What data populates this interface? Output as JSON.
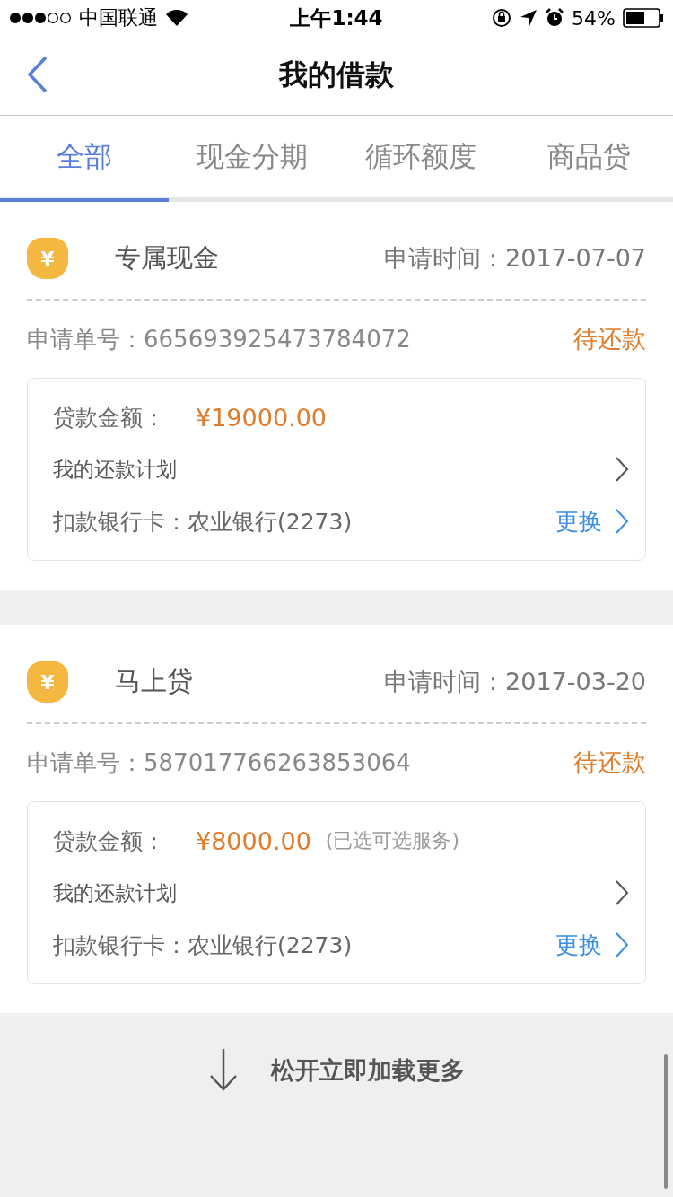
{
  "status_bar": {
    "carrier": "中国联通",
    "time": "上午1:44",
    "battery": "54%"
  },
  "nav": {
    "title": "我的借款"
  },
  "tabs": [
    {
      "label": "全部",
      "selected": true
    },
    {
      "label": "现金分期",
      "selected": false
    },
    {
      "label": "循环额度",
      "selected": false
    },
    {
      "label": "商品贷",
      "selected": false
    }
  ],
  "loans": [
    {
      "icon": "¥",
      "product": "专属现金",
      "date_label": "申请时间：",
      "date": "2017-07-07",
      "order_label": "申请单号：",
      "order_no": "665693925473784072",
      "status": "待还款",
      "amount_label": "贷款金额：",
      "amount": "¥19000.00",
      "plan": "我的还款计划",
      "card_label": "扣款银行卡：",
      "card": "农业银行(2273)",
      "change": "更换"
    },
    {
      "icon": "¥",
      "product": "马上贷",
      "date_label": "申请时间：",
      "date": "2017-03-20",
      "order_label": "申请单号：",
      "order_no": "587017766263853064",
      "status": "待还款",
      "amount_label": "贷款金额：",
      "amount": "¥8000.00",
      "amount_note": "(已选可选服务)",
      "plan": "我的还款计划",
      "card_label": "扣款银行卡：",
      "card": "农业银行(2273)",
      "change": "更换"
    }
  ],
  "pull_hint": "松开立即加载更多"
}
